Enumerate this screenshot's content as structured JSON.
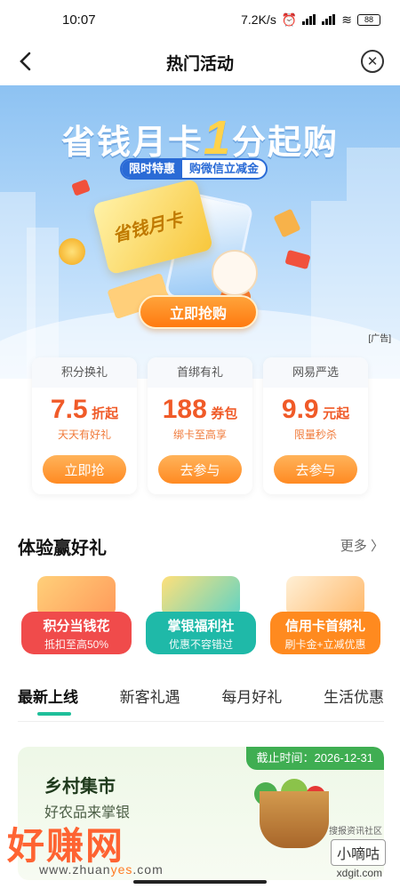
{
  "status_bar": {
    "time": "10:07",
    "network_speed": "7.2K/s",
    "battery": "88"
  },
  "header": {
    "title": "热门活动",
    "back_icon": "chevron-left-icon",
    "close_icon": "close-circle-icon"
  },
  "banner": {
    "headline_part1": "省钱月卡",
    "headline_number": "1",
    "headline_part2": "分起购",
    "tag_left": "限时特惠",
    "tag_right": "购微信立减金",
    "card_text": "省钱月卡",
    "button_label": "立即抢购",
    "ad_label": "[广告]"
  },
  "promos": [
    {
      "title": "积分换礼",
      "value": "7.5",
      "unit": "折起",
      "sub": "天天有好礼",
      "button": "立即抢"
    },
    {
      "title": "首绑有礼",
      "value": "188",
      "unit": "券包",
      "sub": "绑卡至高享",
      "button": "去参与"
    },
    {
      "title": "网易严选",
      "value": "9.9",
      "unit": "元起",
      "sub": "限量秒杀",
      "button": "去参与"
    }
  ],
  "experience": {
    "title": "体验赢好礼",
    "more": "更多",
    "items": [
      {
        "title": "积分当钱花",
        "sub": "抵扣至高50%",
        "color": "#f04b4b"
      },
      {
        "title": "掌银福利社",
        "sub": "优惠不容错过",
        "color": "#1fb9a8"
      },
      {
        "title": "信用卡首绑礼",
        "sub": "刷卡金+立减优惠",
        "color": "#ff8a1f"
      }
    ]
  },
  "tabs": [
    {
      "label": "最新上线",
      "active": true
    },
    {
      "label": "新客礼遇",
      "active": false
    },
    {
      "label": "每月好礼",
      "active": false
    },
    {
      "label": "生活优惠",
      "active": false
    }
  ],
  "activity": {
    "deadline": "截止时间：2026-12-31",
    "title": "乡村集市",
    "subtitle": "好农品来掌银"
  },
  "watermarks": {
    "brand": "好赚网",
    "url_prefix": "www.zhuan",
    "url_mid": "yes",
    "url_suffix": ".com",
    "box": "小嘀咕",
    "small": "搜报资讯社区",
    "xd": "xdgit.com"
  }
}
